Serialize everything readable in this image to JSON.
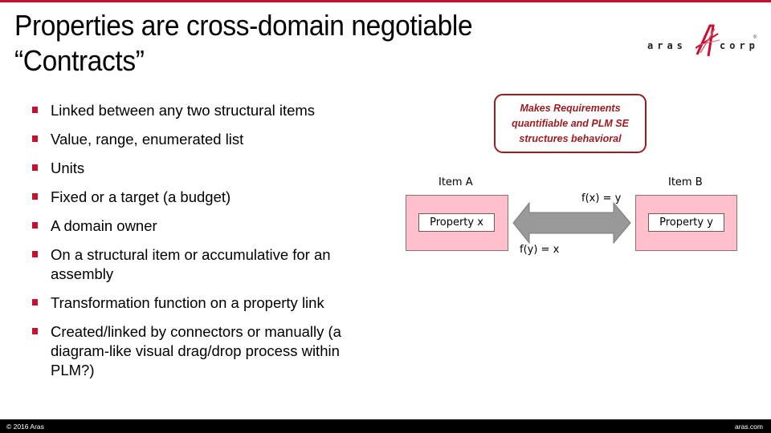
{
  "slide": {
    "title_line1": "Properties are cross-domain negotiable",
    "title_line2": "“Contracts”",
    "accent_color": "#c8102e"
  },
  "logo": {
    "left_text": "aras",
    "right_text": "corp",
    "registered_mark": "®",
    "icon": "aras-a-swoosh-icon"
  },
  "bullets": [
    {
      "text": "Linked between any two structural items"
    },
    {
      "text": "Value, range, enumerated list"
    },
    {
      "text": "Units"
    },
    {
      "text": "Fixed or a target (a budget)"
    },
    {
      "text": "A domain owner"
    },
    {
      "text": "On a structural item or accumulative for an assembly"
    },
    {
      "text": "Transformation function on a property link"
    },
    {
      "text": "Created/linked by connectors or manually (a diagram-like visual drag/drop process within PLM?)"
    }
  ],
  "callout": {
    "text": "Makes Requirements quantifiable and PLM SE structures behavioral",
    "color": "#9b1b1f"
  },
  "diagram": {
    "item_a": {
      "label": "Item A",
      "property": "Property x"
    },
    "item_b": {
      "label": "Item B",
      "property": "Property y"
    },
    "forward_function": "f(x) = y",
    "reverse_function": "f(y) = x",
    "item_fill": "#ffc0cb",
    "arrow_fill": "#999999",
    "arrow_icon": "double-headed-arrow-icon"
  },
  "footer": {
    "left": "© 2016 Aras",
    "right": "aras.com"
  }
}
